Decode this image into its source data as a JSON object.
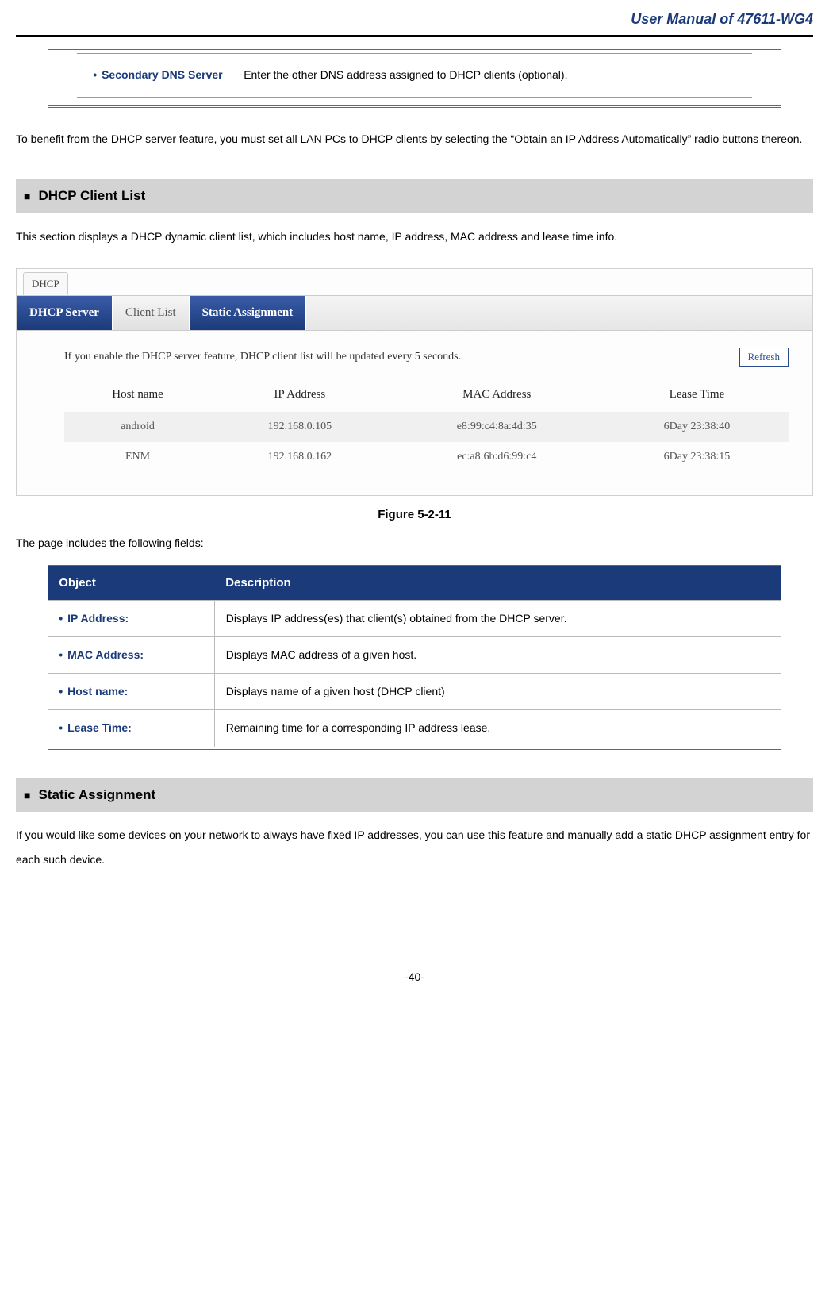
{
  "header": {
    "title": "User Manual of 47611-WG4"
  },
  "param_table": {
    "label": "Secondary DNS Server",
    "desc": "Enter the other DNS address assigned to DHCP clients (optional)."
  },
  "paragraph1": "To benefit from the DHCP server feature, you must set all LAN PCs to DHCP clients by selecting the “Obtain an IP Address Automatically” radio buttons thereon.",
  "section_dhcp_client_list": {
    "heading": "DHCP Client List",
    "intro": "This section displays a DHCP dynamic client list, which includes host name, IP address, MAC address and lease time info."
  },
  "screenshot": {
    "breadcrumb_label": "DHCP",
    "tabs": [
      {
        "label": "DHCP Server",
        "active": false
      },
      {
        "label": "Client List",
        "active": true
      },
      {
        "label": "Static Assignment",
        "active": false
      }
    ],
    "note": "If you enable the DHCP server feature, DHCP client list will be updated every 5 seconds.",
    "refresh_label": "Refresh",
    "columns": [
      "Host name",
      "IP Address",
      "MAC Address",
      "Lease Time"
    ],
    "rows": [
      {
        "host": "android",
        "ip": "192.168.0.105",
        "mac": "e8:99:c4:8a:4d:35",
        "lease": "6Day 23:38:40"
      },
      {
        "host": "ENM",
        "ip": "192.168.0.162",
        "mac": "ec:a8:6b:d6:99:c4",
        "lease": "6Day 23:38:15"
      }
    ]
  },
  "figure_caption": "Figure 5-2-11",
  "fields_intro": "The page includes the following fields:",
  "fields_table": {
    "head_object": "Object",
    "head_desc": "Description",
    "rows": [
      {
        "object": "IP Address:",
        "desc": "Displays IP address(es) that client(s) obtained from the DHCP server."
      },
      {
        "object": "MAC Address:",
        "desc": "Displays MAC address of a given host."
      },
      {
        "object": "Host name:",
        "desc": "Displays name of a given host (DHCP client)"
      },
      {
        "object": "Lease Time:",
        "desc": "Remaining time for a corresponding IP address lease."
      }
    ]
  },
  "section_static": {
    "heading": "Static Assignment",
    "intro": "If you would like some devices on your network to always have fixed IP addresses, you can use this feature and manually add a static DHCP assignment entry for each such device."
  },
  "page_number": "-40-"
}
